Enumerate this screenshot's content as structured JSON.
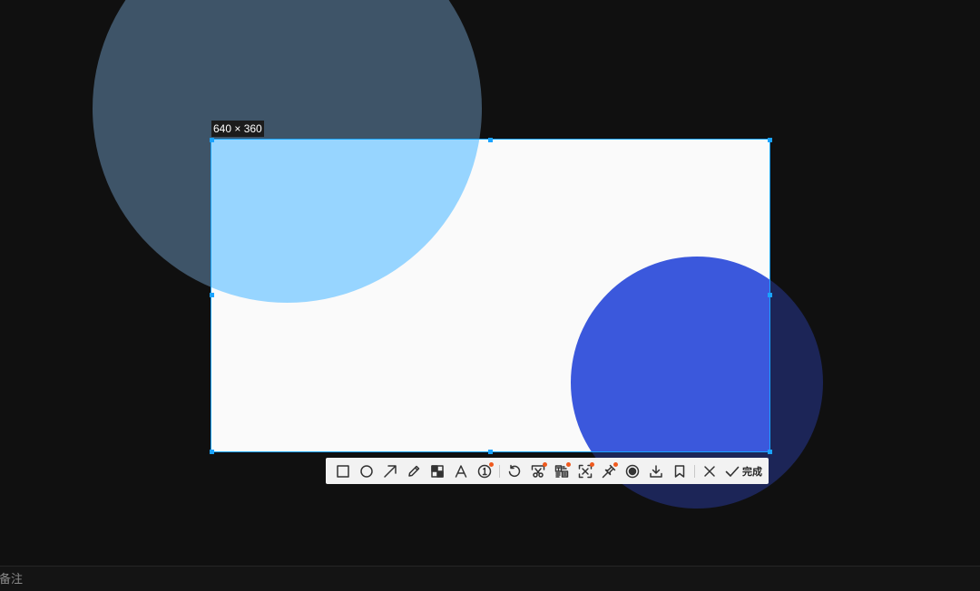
{
  "selection": {
    "size_label": "640 × 360"
  },
  "colors": {
    "accent": "#1aa3ff",
    "circle_top_outside": "#3e5468",
    "circle_top_inside": "#97d5ff",
    "circle_bottom_outside": "#1c2557",
    "circle_bottom_inside": "#3b58dc",
    "badge": "#f05a1e"
  },
  "toolbar": {
    "tools": [
      {
        "icon": "rectangle-icon"
      },
      {
        "icon": "ellipse-icon"
      },
      {
        "icon": "arrow-icon"
      },
      {
        "icon": "pencil-icon"
      },
      {
        "icon": "mosaic-icon"
      },
      {
        "icon": "text-icon"
      },
      {
        "icon": "number-marker-icon"
      },
      {
        "icon": "undo-icon"
      },
      {
        "icon": "long-screenshot-icon"
      },
      {
        "icon": "ocr-icon"
      },
      {
        "icon": "scan-icon"
      },
      {
        "icon": "pin-icon"
      },
      {
        "icon": "record-icon"
      },
      {
        "icon": "download-icon"
      },
      {
        "icon": "bookmark-icon"
      },
      {
        "icon": "close-icon"
      }
    ],
    "done_label": "完成"
  },
  "footer": {
    "note_label": "备注"
  }
}
